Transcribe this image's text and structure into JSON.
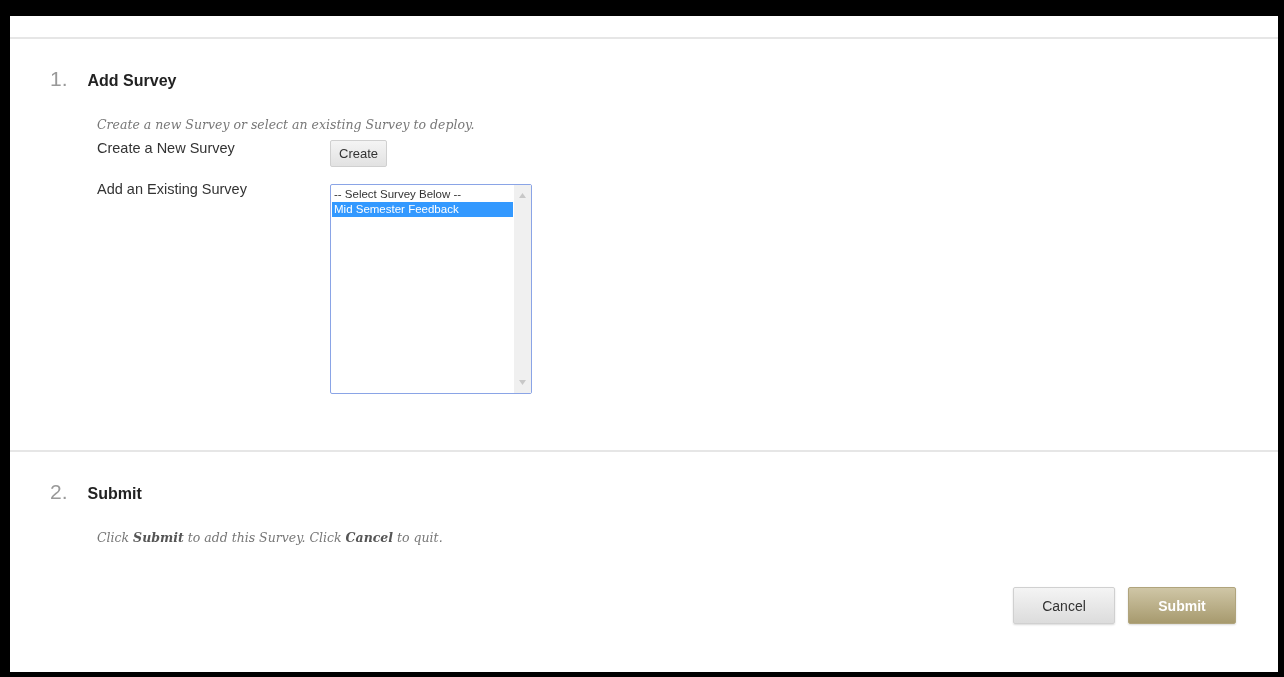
{
  "sections": [
    {
      "number": "1.",
      "title": "Add Survey",
      "instructions": "Create a new Survey or select an existing Survey to deploy.",
      "fields": [
        {
          "kind": "button",
          "label": "Create a New Survey",
          "button": "Create"
        },
        {
          "kind": "listbox",
          "label": "Add an Existing Survey",
          "options": [
            {
              "text": "-- Select Survey Below --",
              "selected": false
            },
            {
              "text": "Mid Semester Feedback",
              "selected": true
            }
          ]
        }
      ]
    },
    {
      "number": "2.",
      "title": "Submit",
      "instructions": "Click **Submit** to add this Survey. Click **Cancel** to quit."
    }
  ],
  "actions": [
    {
      "kind": "secondary",
      "label": "Cancel"
    },
    {
      "kind": "primary",
      "label": "Submit"
    }
  ]
}
